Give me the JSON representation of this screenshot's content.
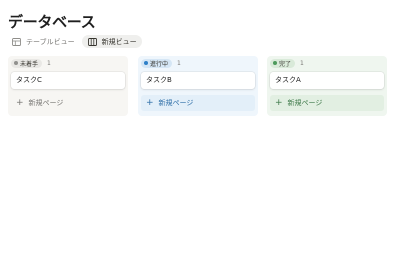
{
  "page": {
    "title": "データベース"
  },
  "views": [
    {
      "label": "テーブルビュー",
      "icon": "table-icon",
      "active": false
    },
    {
      "label": "新規ビュー",
      "icon": "board-icon",
      "active": true
    }
  ],
  "columns": [
    {
      "status": "未着手",
      "count": "1",
      "dot_color": "#91918e",
      "card": "タスクC",
      "new_page": "新規ページ"
    },
    {
      "status": "進行中",
      "count": "1",
      "dot_color": "#2f80c8",
      "card": "タスクB",
      "new_page": "新規ページ"
    },
    {
      "status": "完了",
      "count": "1",
      "dot_color": "#4d9a5c",
      "card": "タスクA",
      "new_page": "新規ページ"
    }
  ],
  "icons": {
    "plus": "+"
  }
}
